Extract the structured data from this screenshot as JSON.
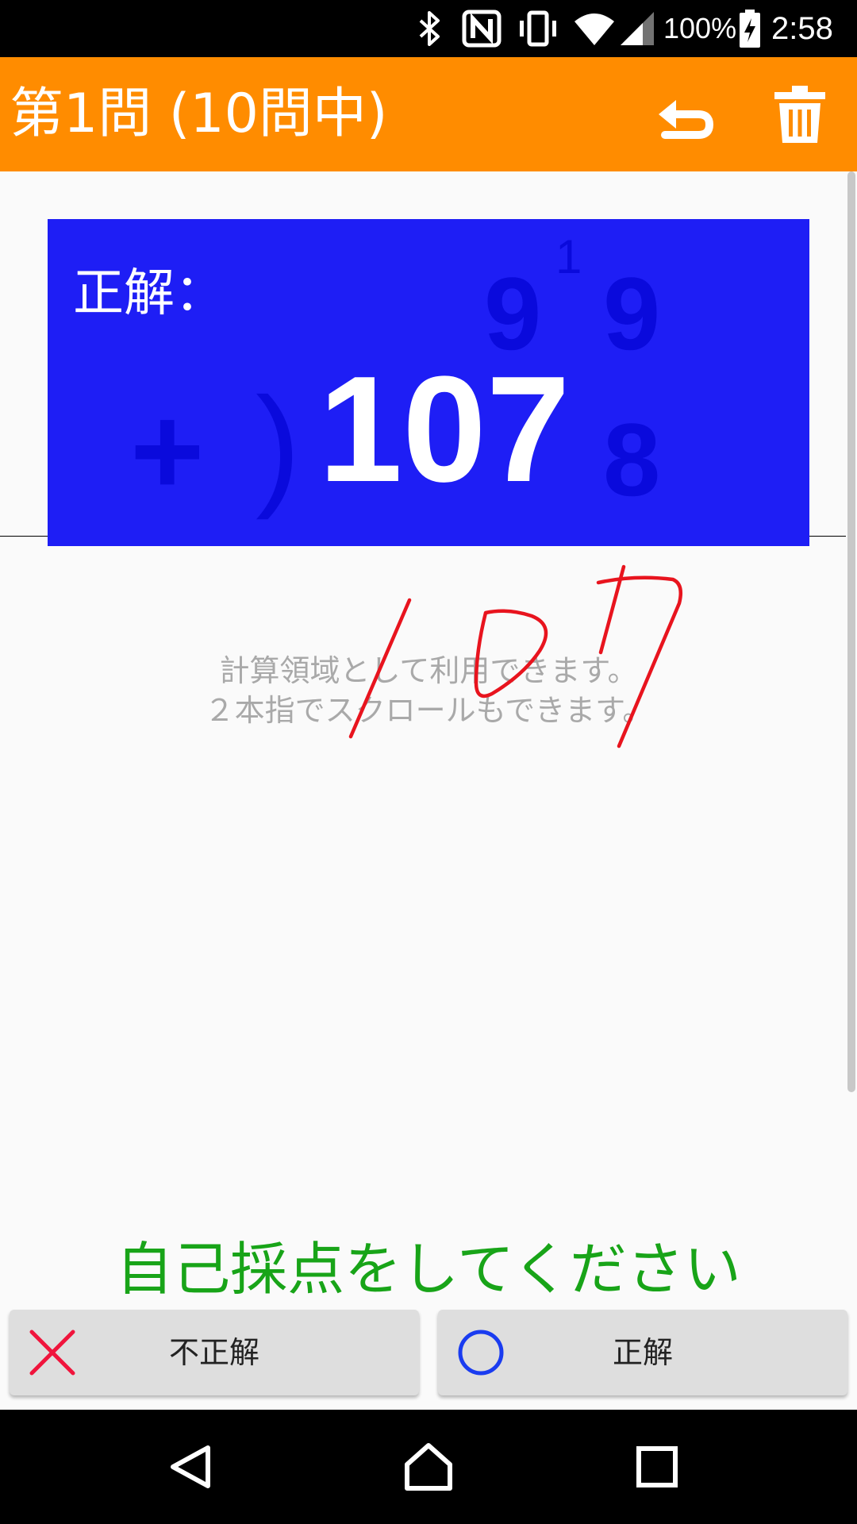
{
  "status_bar": {
    "battery": "100%",
    "time": "2:58",
    "icons": [
      "bluetooth-icon",
      "nfc-icon",
      "vibrate-icon",
      "wifi-icon",
      "signal-icon",
      "battery-charging-icon"
    ]
  },
  "app_bar": {
    "title": "第1問 (10問中)",
    "actions": [
      "undo-icon",
      "trash-icon"
    ]
  },
  "answer_card": {
    "label": "正解：",
    "value": "107",
    "background": "#1e1ef5"
  },
  "problem_ghost": {
    "top_tens": "9",
    "top_ones": "9",
    "carry": "1",
    "operator": "+",
    "paren": ")",
    "bottom_ones": "8"
  },
  "hint": {
    "line1": "計算領域として利用できます。",
    "line2": "２本指でスクロールもできます。"
  },
  "prompt": {
    "text": "自己採点をしてください",
    "color": "#18a418"
  },
  "buttons": {
    "incorrect_label": "不正解",
    "correct_label": "正解"
  },
  "nav_bar": {
    "icons": [
      "back-icon",
      "home-icon",
      "recents-icon"
    ]
  },
  "colors": {
    "app_bar": "#ff8c00",
    "handwriting": "#e8141e"
  }
}
